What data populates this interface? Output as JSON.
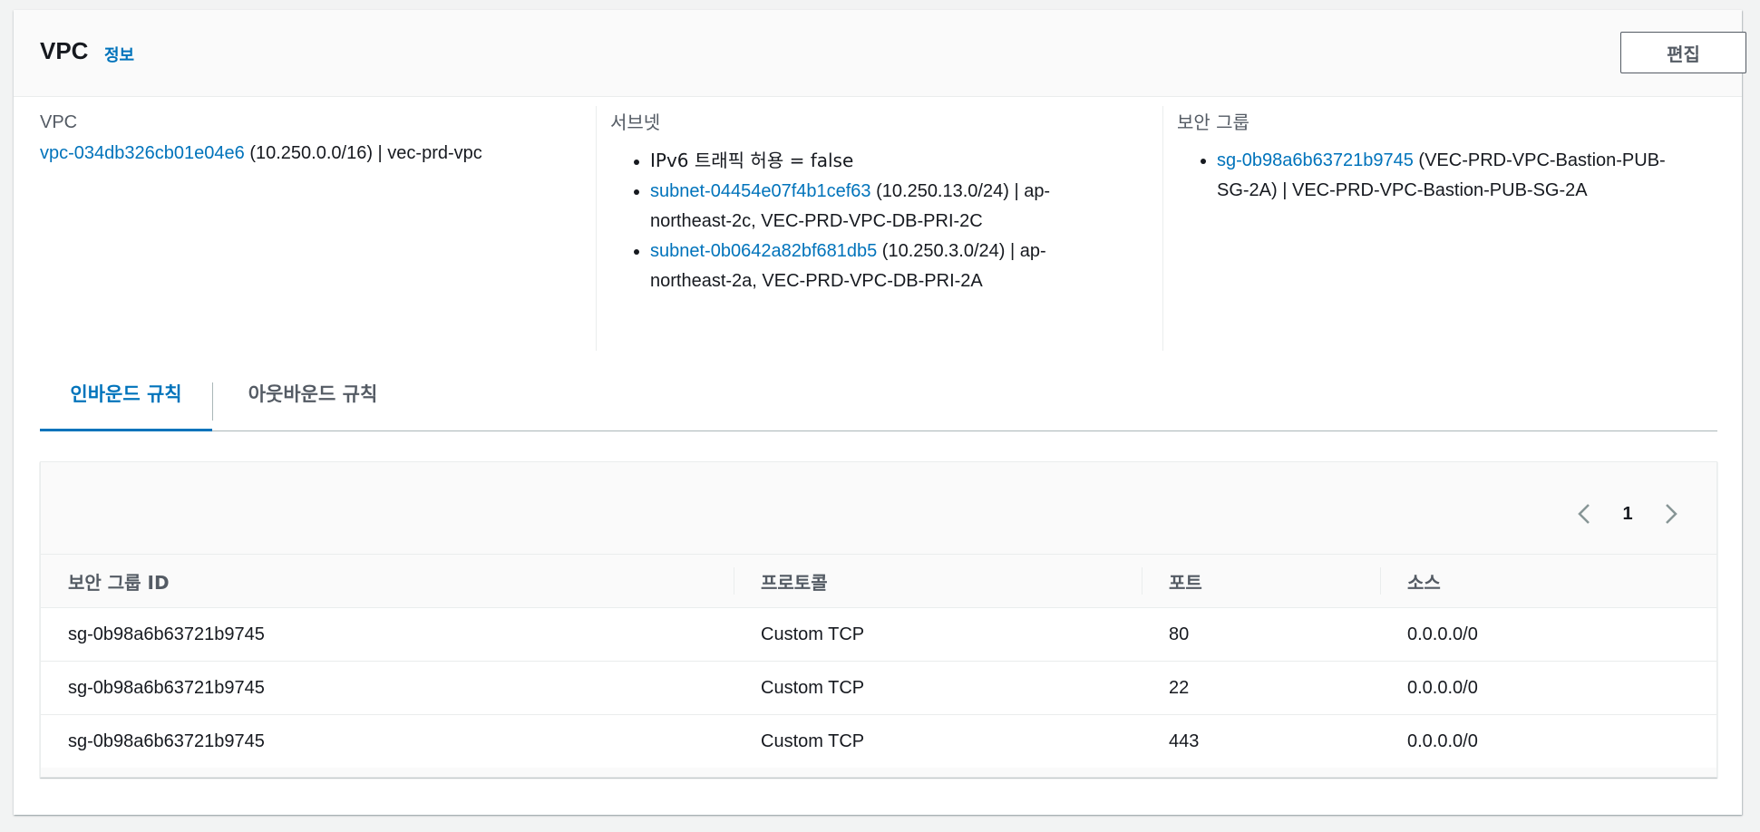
{
  "header": {
    "title": "VPC",
    "info_link": "정보",
    "edit_button": "편집"
  },
  "vpc": {
    "label": "VPC",
    "id_link": "vpc-034db326cb01e04e6",
    "detail": "(10.250.0.0/16) | vec-prd-vpc"
  },
  "subnets": {
    "label": "서브넷",
    "ipv6": "IPv6 트래픽 허용 = false",
    "items": [
      {
        "id": "subnet-04454e07f4b1cef63",
        "detail_1": " (10.250.13.0/24) | ap-",
        "detail_2": "northeast-2c, VEC-PRD-VPC-DB-PRI-2C"
      },
      {
        "id": "subnet-0b0642a82bf681db5",
        "detail_1": " (10.250.3.0/24) | ap-",
        "detail_2": "northeast-2a, VEC-PRD-VPC-DB-PRI-2A"
      }
    ]
  },
  "security_groups": {
    "label": "보안 그룹",
    "items": [
      {
        "id": "sg-0b98a6b63721b9745",
        "detail_1": " (VEC-PRD-VPC-Bastion-PUB-",
        "detail_2": "SG-2A) | VEC-PRD-VPC-Bastion-PUB-SG-2A"
      }
    ]
  },
  "tabs": {
    "inbound": "인바운드 규칙",
    "outbound": "아웃바운드 규칙"
  },
  "pagination": {
    "current_page": "1"
  },
  "rules_table": {
    "columns": [
      "보안 그룹 ID",
      "프로토콜",
      "포트",
      "소스"
    ],
    "rows": [
      [
        "sg-0b98a6b63721b9745",
        "Custom TCP",
        "80",
        "0.0.0.0/0"
      ],
      [
        "sg-0b98a6b63721b9745",
        "Custom TCP",
        "22",
        "0.0.0.0/0"
      ],
      [
        "sg-0b98a6b63721b9745",
        "Custom TCP",
        "443",
        "0.0.0.0/0"
      ]
    ]
  },
  "colors": {
    "link": "#0073bb",
    "text": "#16191f",
    "muted": "#545b64",
    "page_bg": "#f2f3f3"
  }
}
